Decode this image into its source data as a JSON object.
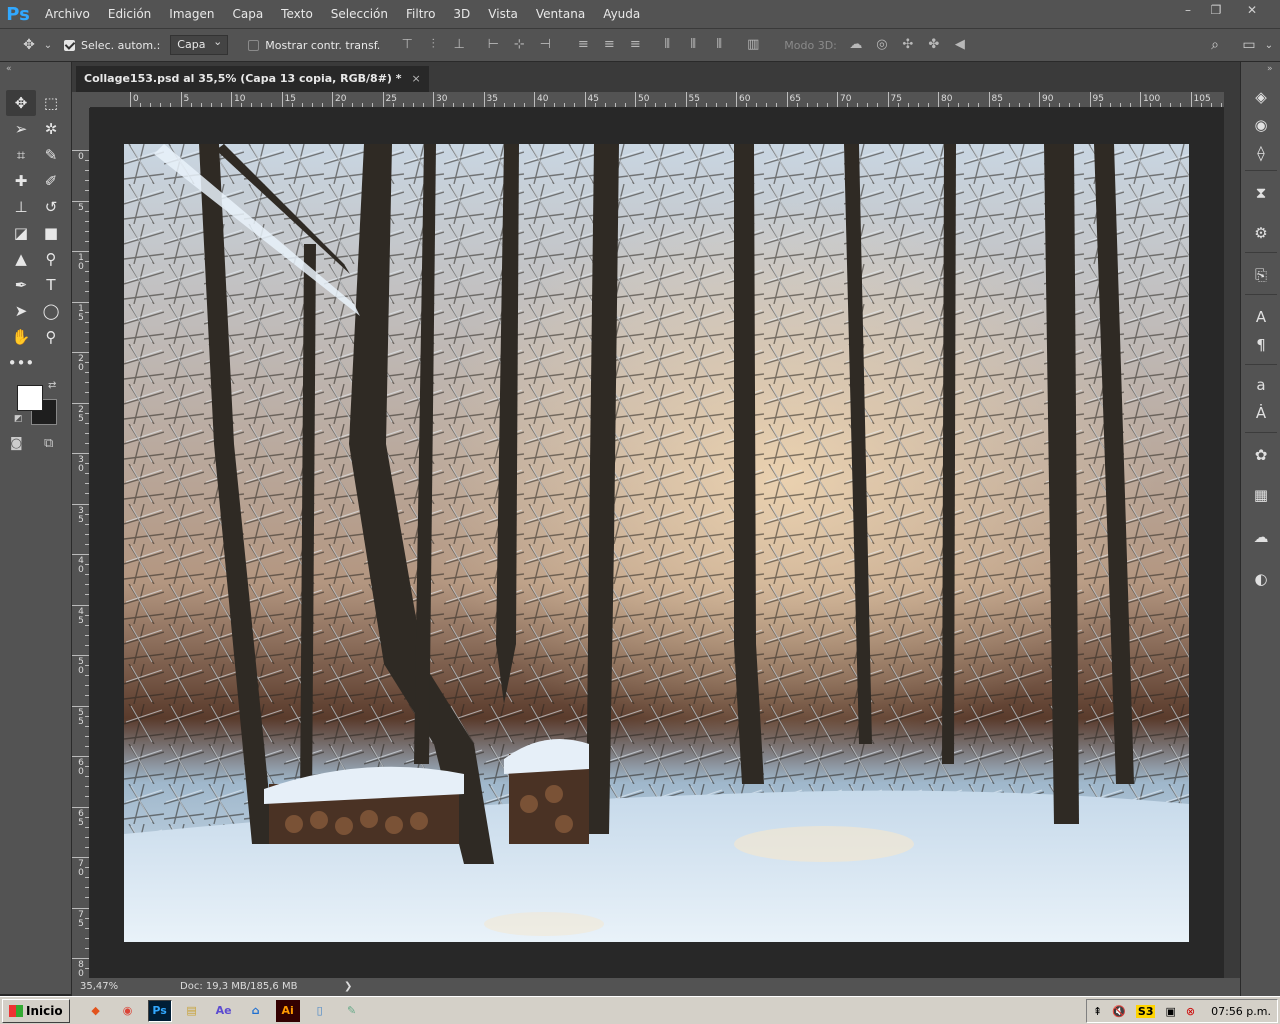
{
  "app": {
    "logo": "Ps"
  },
  "menu": [
    "Archivo",
    "Edición",
    "Imagen",
    "Capa",
    "Texto",
    "Selección",
    "Filtro",
    "3D",
    "Vista",
    "Ventana",
    "Ayuda"
  ],
  "options": {
    "auto_select_label": "Selec. autom.:",
    "auto_select_checked": true,
    "target_value": "Capa",
    "show_transform_label": "Mostrar contr. transf.",
    "show_transform_checked": false,
    "mode3d_label": "Modo 3D:"
  },
  "document_tab": {
    "title": "Collage153.psd al 35,5% (Capa 13 copia, RGB/8#) *",
    "close": "×"
  },
  "rulers": {
    "horizontal": [
      "0",
      "5",
      "10",
      "15",
      "20",
      "25",
      "30",
      "35",
      "40",
      "45",
      "50",
      "55",
      "60",
      "65",
      "70",
      "75",
      "80",
      "85",
      "90",
      "95",
      "100",
      "105"
    ],
    "vertical": [
      "0",
      "5",
      "10",
      "15",
      "20",
      "25",
      "30",
      "35",
      "40",
      "45",
      "50",
      "55",
      "60",
      "65",
      "70",
      "75",
      "80"
    ]
  },
  "status": {
    "zoom": "35,47%",
    "doc_size": "Doc: 19,3 MB/185,6 MB",
    "arrow": "❯"
  },
  "colors": {
    "foreground": "#ffffff",
    "background": "#1e1e1e",
    "ui_dark": "#282828",
    "ui_panel": "#535353",
    "ps_blue": "#31a8ff"
  },
  "taskbar": {
    "start_label": "Inicio",
    "apps": [
      "brave-icon",
      "chrome-icon",
      "photoshop-icon",
      "explorer-icon",
      "after-effects-icon",
      "onedrive-icon",
      "illustrator-icon",
      "notepad-icon",
      "paint-icon"
    ],
    "clock": "07:56 p.m."
  },
  "right_panels": [
    "layers-icon",
    "channels-icon",
    "paths-icon",
    "history-icon",
    "properties-icon",
    "clone-source-icon",
    "character-icon",
    "paragraph-icon",
    "character-styles-icon",
    "paragraph-styles-icon",
    "swatches-icon",
    "grid-icon",
    "libraries-icon",
    "adjustments-icon"
  ]
}
